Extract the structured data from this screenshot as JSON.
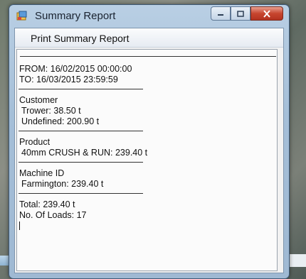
{
  "window": {
    "title": "Summary Report"
  },
  "menu": {
    "print_label": "Print Summary Report"
  },
  "report": {
    "from": "FROM: 16/02/2015 00:00:00",
    "to": "TO: 16/03/2015 23:59:59",
    "customer_header": "Customer",
    "customers": [
      "Trower: 38.50 t",
      "Undefined: 200.90 t"
    ],
    "product_header": "Product",
    "products": [
      "40mm CRUSH & RUN: 239.40 t"
    ],
    "machine_header": "Machine ID",
    "machines": [
      "Farmington: 239.40 t"
    ],
    "total": "Total: 239.40 t",
    "loads": "No. Of Loads: 17"
  },
  "colors": {
    "close_button": "#c7452f",
    "title_bar": "#b9cfe4"
  }
}
